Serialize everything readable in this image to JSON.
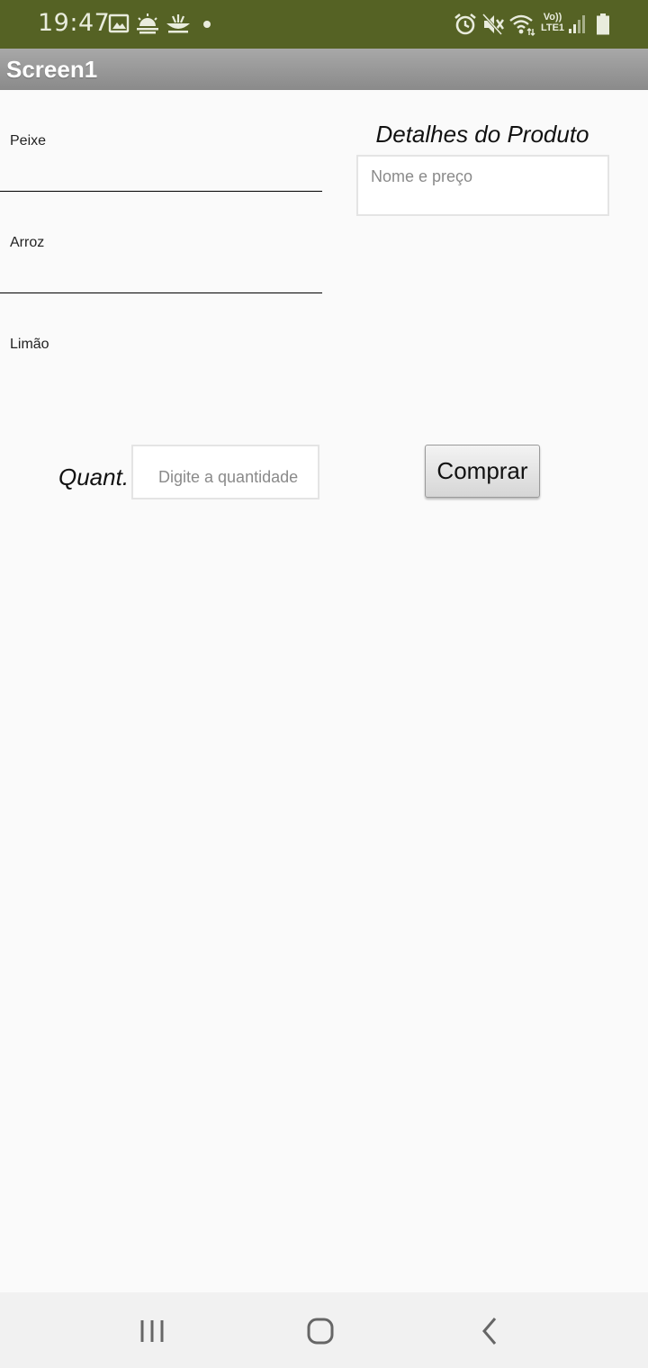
{
  "status_bar": {
    "time": "19:47",
    "left_icons": [
      "image-icon",
      "weather-icon",
      "notification-app-icon",
      "dot-icon"
    ],
    "right_icons": [
      "alarm-icon",
      "mute-icon",
      "wifi-icon",
      "volte-lte-icon",
      "signal-icon",
      "battery-icon"
    ],
    "volte_label_top": "Vo))",
    "volte_label_bottom": "LTE1",
    "background": "#556224"
  },
  "app": {
    "title": "Screen1",
    "title_bar_color": "#9a9a9a"
  },
  "products": [
    {
      "label": "Peixe"
    },
    {
      "label": "Arroz"
    },
    {
      "label": "Limão"
    }
  ],
  "details": {
    "title": "Detalhes do Produto",
    "placeholder": "Nome e preço"
  },
  "quantity": {
    "label": "Quant.",
    "placeholder": "Digite a quantidade"
  },
  "buy_button": {
    "label": "Comprar"
  },
  "nav_bar": {
    "buttons": [
      "recent-apps-icon",
      "home-icon",
      "back-icon"
    ]
  }
}
